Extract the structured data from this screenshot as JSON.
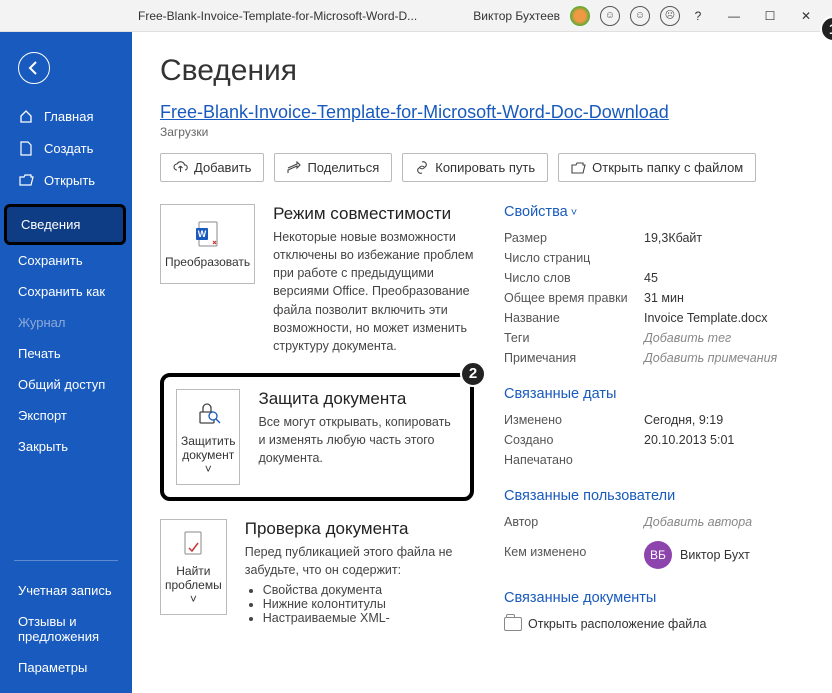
{
  "titlebar": {
    "doc": "Free-Blank-Invoice-Template-for-Microsoft-Word-D...",
    "user": "Виктор Бухтеев"
  },
  "sidebar": {
    "home": "Главная",
    "new": "Создать",
    "open": "Открыть",
    "info": "Сведения",
    "save": "Сохранить",
    "saveas": "Сохранить как",
    "history": "Журнал",
    "print": "Печать",
    "share": "Общий доступ",
    "export": "Экспорт",
    "close": "Закрыть",
    "account": "Учетная запись",
    "feedback": "Отзывы и предложения",
    "options": "Параметры"
  },
  "page": {
    "title": "Сведения",
    "doc_link": "Free-Blank-Invoice-Template-for-Microsoft-Word-Doc-Download",
    "breadcrumb": "Загрузки"
  },
  "actions": {
    "upload": "Добавить",
    "share": "Поделиться",
    "copypath": "Копировать путь",
    "openfolder": "Открыть папку с файлом"
  },
  "cards": {
    "convert_btn": "Преобразовать",
    "compat_title": "Режим совместимости",
    "compat_body": "Некоторые новые возможности отключены во избежание проблем при работе с предыдущими версиями Office. Преобразование файла позволит включить эти возможности, но может изменить структуру документа.",
    "protect_btn": "Защитить документ ˅",
    "protect_title": "Защита документа",
    "protect_body": "Все могут открывать, копировать и изменять любую часть этого документа.",
    "inspect_btn": "Найти проблемы ˅",
    "inspect_title": "Проверка документа",
    "inspect_body": "Перед публикацией этого файла не забудьте, что он содержит:",
    "inspect_li1": "Свойства документа",
    "inspect_li2": "Нижние колонтитулы",
    "inspect_li3": "Настраиваемые XML-"
  },
  "props": {
    "header": "Свойства",
    "size_k": "Размер",
    "size_v": "19,3Кбайт",
    "pages_k": "Число страниц",
    "words_k": "Число слов",
    "words_v": "45",
    "edittime_k": "Общее время правки",
    "edittime_v": "31 мин",
    "title_k": "Название",
    "title_v": "Invoice Template.docx",
    "tags_k": "Теги",
    "tags_v": "Добавить тег",
    "comments_k": "Примечания",
    "comments_v": "Добавить примечания"
  },
  "dates": {
    "header": "Связанные даты",
    "modified_k": "Изменено",
    "modified_v": "Сегодня, 9:19",
    "created_k": "Создано",
    "created_v": "20.10.2013 5:01",
    "printed_k": "Напечатано"
  },
  "people": {
    "header": "Связанные пользователи",
    "author_k": "Автор",
    "author_v": "Добавить автора",
    "lastmod_k": "Кем изменено",
    "initials": "ВБ",
    "name": "Виктор Бухт"
  },
  "related": {
    "header": "Связанные документы",
    "openloc": "Открыть расположение файла"
  }
}
